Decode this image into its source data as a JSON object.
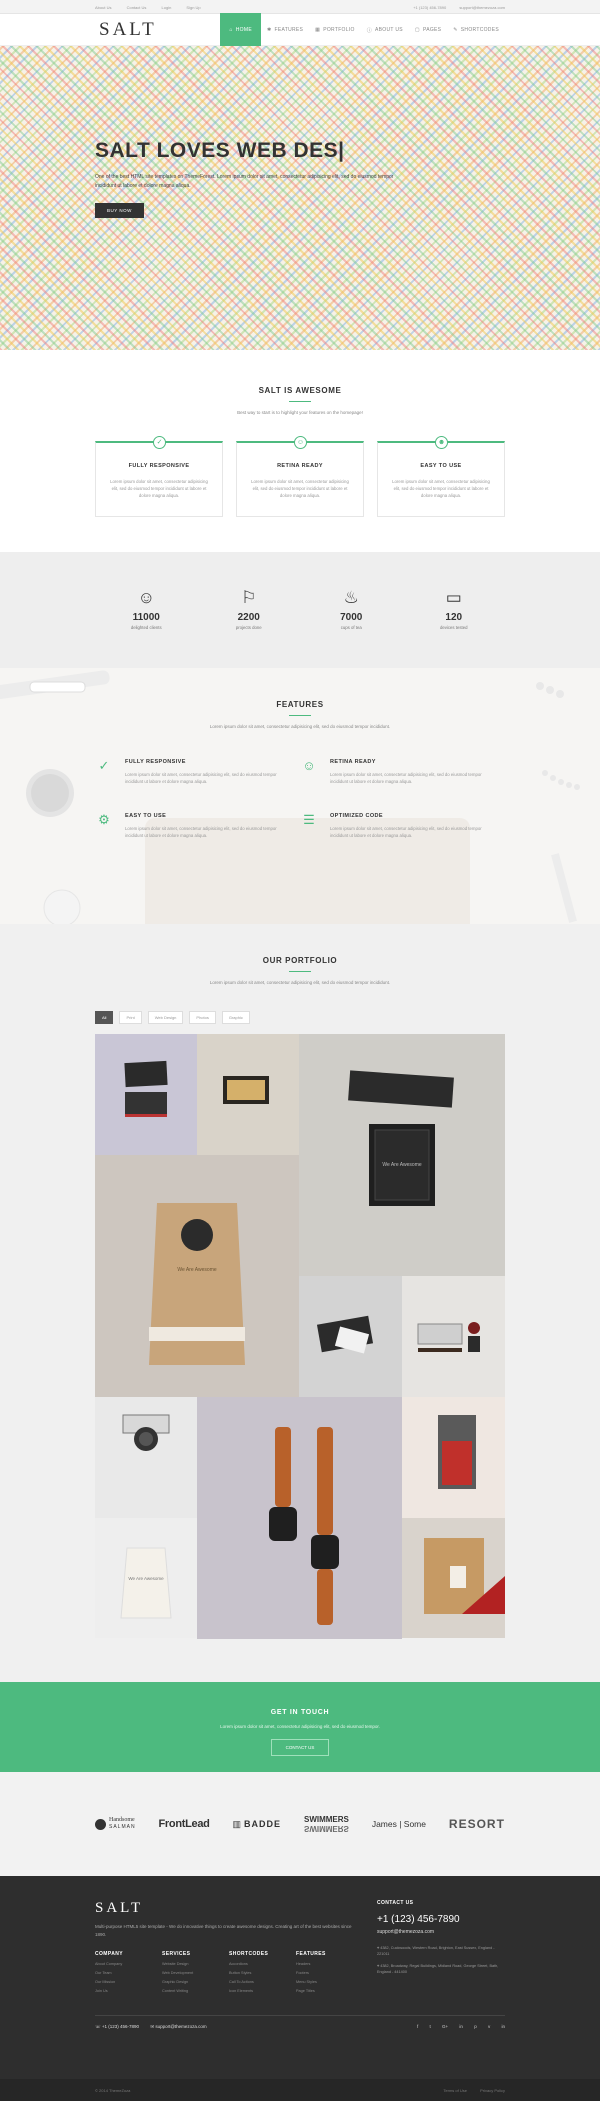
{
  "topbar": {
    "links": [
      "About Us",
      "Contact Us",
      "Login",
      "Sign Up"
    ],
    "phone": "+1 (123) 456-7890",
    "email": "support@themezoza.com"
  },
  "nav": {
    "logo": "SALT",
    "items": [
      {
        "label": "HOME",
        "icon": "home-icon"
      },
      {
        "label": "FEATURES",
        "icon": "bulb-icon"
      },
      {
        "label": "PORTFOLIO",
        "icon": "grid-icon"
      },
      {
        "label": "ABOUT US",
        "icon": "info-icon"
      },
      {
        "label": "PAGES",
        "icon": "file-icon"
      },
      {
        "label": "SHORTCODES",
        "icon": "magic-icon"
      }
    ]
  },
  "hero": {
    "title": "SALT LOVES WEB DES|",
    "text": "One of the best HTML site templates on ThemeForest. Lorem ipsum dolor sit amet, consectetur adipisicing elit, sed do eiusmod tempor incididunt ut labore et dolore magna aliqua.",
    "button": "BUY NOW"
  },
  "awesome": {
    "title": "SALT IS AWESOME",
    "subtitle": "Best way to start is to highlight your features on the homepage!",
    "cards": [
      {
        "title": "FULLY RESPONSIVE",
        "text": "Lorem ipsum dolor sit amet, consectetur adipisicing elit, sed do eiusmod tempor incididunt ut labore et dolore magna aliqua.",
        "icon": "check-icon"
      },
      {
        "title": "RETINA READY",
        "text": "Lorem ipsum dolor sit amet, consectetur adipisicing elit, sed do eiusmod tempor incididunt ut labore et dolore magna aliqua.",
        "icon": "face-icon"
      },
      {
        "title": "EASY TO USE",
        "text": "Lorem ipsum dolor sit amet, consectetur adipisicing elit, sed do eiusmod tempor incididunt ut labore et dolore magna aliqua.",
        "icon": "smile-icon"
      }
    ]
  },
  "counters": [
    {
      "value": "11000",
      "label": "delighted clients",
      "icon": "smiley-icon"
    },
    {
      "value": "2200",
      "label": "projects done",
      "icon": "flag-icon"
    },
    {
      "value": "7000",
      "label": "cups of tea",
      "icon": "drop-icon"
    },
    {
      "value": "120",
      "label": "devices tested",
      "icon": "monitor-icon"
    }
  ],
  "features": {
    "title": "FEATURES",
    "subtitle": "Lorem ipsum dolor sit amet, consectetur adipisicing elit, sed do eiusmod tempor incididunt.",
    "items": [
      {
        "title": "FULLY RESPONSIVE",
        "text": "Lorem ipsum dolor sit amet, consectetur adipisicing elit, sed do eiusmod tempor incididunt ut labore et dolore magna aliqua.",
        "icon": "check-circle-icon"
      },
      {
        "title": "RETINA READY",
        "text": "Lorem ipsum dolor sit amet, consectetur adipisicing elit, sed do eiusmod tempor incididunt ut labore et dolore magna aliqua.",
        "icon": "face-icon"
      },
      {
        "title": "EASY TO USE",
        "text": "Lorem ipsum dolor sit amet, consectetur adipisicing elit, sed do eiusmod tempor incididunt ut labore et dolore magna aliqua.",
        "icon": "gear-icon"
      },
      {
        "title": "OPTIMIZED CODE",
        "text": "Lorem ipsum dolor sit amet, consectetur adipisicing elit, sed do eiusmod tempor incididunt ut labore et dolore magna aliqua.",
        "icon": "sliders-icon"
      }
    ]
  },
  "portfolio": {
    "title": "OUR PORTFOLIO",
    "subtitle": "Lorem ipsum dolor sit amet, consectetur adipisicing elit, sed do eiusmod tempor incididunt.",
    "filters": [
      "All",
      "Print",
      "Web Design",
      "Photos",
      "Graphic"
    ],
    "tiles": [
      {
        "caption": ""
      },
      {
        "caption": ""
      },
      {
        "caption": "We Are Awesome"
      },
      {
        "caption": "We Are Awesome"
      },
      {
        "caption": ""
      },
      {
        "caption": ""
      },
      {
        "caption": ""
      },
      {
        "caption": ""
      },
      {
        "caption": ""
      },
      {
        "caption": "We Are Awesome"
      },
      {
        "caption": ""
      }
    ]
  },
  "touch": {
    "title": "GET IN TOUCH",
    "text": "Lorem ipsum dolor sit amet, consectetur adipisicing elit, sed do eiusmod tempor.",
    "button": "CONTACT US"
  },
  "clients": [
    {
      "line1": "Handsome",
      "line2": "SALMAN"
    },
    {
      "line1": "FrontLead",
      "line2": ""
    },
    {
      "line1": "BADDE",
      "line2": ""
    },
    {
      "line1": "SWIMMERS",
      "line2": "SWIMMERS"
    },
    {
      "line1": "James | Some",
      "line2": ""
    },
    {
      "line1": "RESORT",
      "line2": ""
    }
  ],
  "footer": {
    "logo": "SALT",
    "description": "Multi-purpose HTML5 site template - We do innovative things to create awesome designs. Creating art of the best websites since 1890.",
    "columns": [
      {
        "title": "COMPANY",
        "links": [
          "About Company",
          "Our Team",
          "Our Mission",
          "Join Us"
        ]
      },
      {
        "title": "SERVICES",
        "links": [
          "Website Design",
          "Web Development",
          "Graphic Design",
          "Content Writing"
        ]
      },
      {
        "title": "SHORTCODES",
        "links": [
          "Accordions",
          "Button Styles",
          "Call To Actions",
          "Icon Elements"
        ]
      },
      {
        "title": "FEATURES",
        "links": [
          "Headers",
          "Footers",
          "Menu Styles",
          "Page Titles"
        ]
      }
    ],
    "contact_title": "CONTACT US",
    "phone": "+1 (123) 456-7890",
    "email": "support@themezoza.com",
    "address1": "4382, Cuckwoods, Western Road, Brighton, East Sussex, England - 221011",
    "address2": "4382, Broadway, Regal Buildings, Midland Road, George Street, Bath, England - 441400",
    "bar_phone": "+1 (123) 456-7890",
    "bar_email": "support@themezoza.com",
    "socials": [
      "f",
      "t",
      "G+",
      "in",
      "p",
      "v",
      "in"
    ],
    "copyright": "© 2014 ThemeZoza",
    "bottom_links": [
      "Terms of Use",
      "Privacy Policy"
    ]
  }
}
